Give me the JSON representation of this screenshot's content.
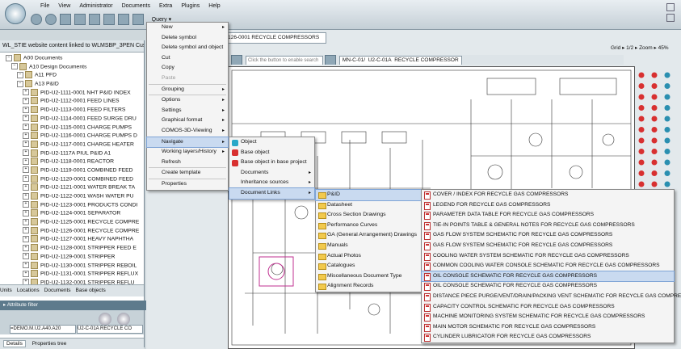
{
  "menubar": {
    "items": [
      "File",
      "View",
      "Administrator",
      "Documents",
      "Extra",
      "Plugins",
      "Help"
    ]
  },
  "toolbar": {
    "query_label": "Query"
  },
  "left_panel": {
    "header": "WL_STIE  website content linked to WLMSBP_3PEN  Cus",
    "tree": [
      {
        "indent": 1,
        "label": "A00  Documents"
      },
      {
        "indent": 2,
        "label": "A10  Design Documents"
      },
      {
        "indent": 3,
        "label": "A11   PFD"
      },
      {
        "indent": 3,
        "label": "A13   P&ID"
      },
      {
        "indent": 4,
        "label": "PID-U2-1111-0001  NHT P&ID INDEX"
      },
      {
        "indent": 4,
        "label": "PID-U2-1112-0001  FEED LINES"
      },
      {
        "indent": 4,
        "label": "PID-U2-1113-0001  FEED FILTERS"
      },
      {
        "indent": 4,
        "label": "PID-U2-1114-0001  FEED SURGE DRU"
      },
      {
        "indent": 4,
        "label": "PID-U2-1115-0001  CHARGE PUMPS"
      },
      {
        "indent": 4,
        "label": "PID-U2-1116-0001  CHARGE PUMPS D"
      },
      {
        "indent": 4,
        "label": "PID-U2-1117-0001  CHARGE HEATER"
      },
      {
        "indent": 4,
        "label": "PID-U2-1117A  PIUL P&ID A1"
      },
      {
        "indent": 4,
        "label": "PID-U2-1118-0001  REACTOR"
      },
      {
        "indent": 4,
        "label": "PID-U2-1119-0001  COMBINED FEED"
      },
      {
        "indent": 4,
        "label": "PID-U2-1120-0001  COMBINED FEED"
      },
      {
        "indent": 4,
        "label": "PID-U2-1121-0001  WATER BREAK TA"
      },
      {
        "indent": 4,
        "label": "PID-U2-1122-0001  WASH WATER PU"
      },
      {
        "indent": 4,
        "label": "PID-U2-1123-0001  PRODUCTS CONDI"
      },
      {
        "indent": 4,
        "label": "PID-U2-1124-0001  SEPARATOR"
      },
      {
        "indent": 4,
        "label": "PID-U2-1125-0001  RECYCLE COMPRE"
      },
      {
        "indent": 4,
        "label": "PID-U2-1126-0001  RECYCLE COMPRE"
      },
      {
        "indent": 4,
        "label": "PID-U2-1127-0001  HEAVY NAPHTHA"
      },
      {
        "indent": 4,
        "label": "PID-U2-1128-0001  STRIPPER FEED E"
      },
      {
        "indent": 4,
        "label": "PID-U2-1129-0001  STRIPPER"
      },
      {
        "indent": 4,
        "label": "PID-U2-1130-0001  STRIPPER REBOIL"
      },
      {
        "indent": 4,
        "label": "PID-U2-1131-0001  STRIPPER REFLUX"
      },
      {
        "indent": 4,
        "label": "PID-U2-1132-0001  STRIPPER REFLU"
      }
    ],
    "tabs": [
      "Units",
      "Locations",
      "Documents",
      "Base objects"
    ],
    "attribute_filter": "Attribute filter",
    "attr_values": [
      "=DEMO.M.U2.A40.A20",
      "U2-C-01A RECYCLE CO"
    ],
    "bottom_tabs": [
      "Details",
      "Properties tree"
    ]
  },
  "document": {
    "tab_title": "1126-0001  RECYCLE COMPRESSORS",
    "grid_label": "Grid",
    "page": "1/2",
    "zoom_label": "Zoom",
    "zoom_value": "45%",
    "input_placeholder": "Click the button to enable search",
    "breadcrumb": [
      "MN-C-01/",
      "U2-C-01A",
      "RECYCLE COMPRESSOR"
    ]
  },
  "context_menu": {
    "items": [
      {
        "label": "New",
        "arrow": true
      },
      {
        "label": "Delete symbol"
      },
      {
        "label": "Delete symbol and object"
      },
      {
        "label": "Cut"
      },
      {
        "label": "Copy"
      },
      {
        "label": "Paste",
        "disabled": true
      },
      {
        "label": "Grouping",
        "arrow": true,
        "sep": true
      },
      {
        "label": "Options",
        "arrow": true,
        "sep": true
      },
      {
        "label": "Settings",
        "arrow": true
      },
      {
        "label": "Graphical format",
        "arrow": true
      },
      {
        "label": "COMOS-3D-Viewing",
        "arrow": true
      },
      {
        "label": "Navigate",
        "arrow": true,
        "highlight": true,
        "sep": true
      },
      {
        "label": "Working layers/History",
        "arrow": true
      },
      {
        "label": "Refresh"
      },
      {
        "label": "Create template",
        "sep": true
      },
      {
        "label": "Properties",
        "sep": true
      }
    ]
  },
  "navigate_menu": {
    "items": [
      {
        "label": "Object"
      },
      {
        "label": "Base object"
      },
      {
        "label": "Base object in base project"
      },
      {
        "label": "Documents",
        "arrow": true
      },
      {
        "label": "Inheritance sources",
        "arrow": true
      },
      {
        "label": "Document Links",
        "arrow": true,
        "highlight": true
      }
    ]
  },
  "doc_types_menu": {
    "items": [
      {
        "label": "P&ID",
        "highlight": true
      },
      {
        "label": "Datasheet"
      },
      {
        "label": "Cross Section Drawings"
      },
      {
        "label": "Performance Curves"
      },
      {
        "label": "GA (General Arrangement) Drawings"
      },
      {
        "label": "Manuals"
      },
      {
        "label": "Actual Photos"
      },
      {
        "label": "Catalogues"
      },
      {
        "label": "Miscellaneous Document Type"
      },
      {
        "label": "Alignment Records"
      }
    ]
  },
  "doc_links_menu": {
    "items": [
      {
        "label": "COVER / INDEX FOR RECYCLE GAS COMPRESSORS"
      },
      {
        "label": "LEGEND FOR RECYCLE GAS COMPRESSORS"
      },
      {
        "label": "PARAMETER DATA TABLE FOR RECYCLE GAS COMPRESSORS"
      },
      {
        "label": "TIE-IN POINTS TABLE & GENERAL NOTES FOR RECYCLE GAS COMPRESSORS"
      },
      {
        "label": "GAS FLOW SYSTEM SCHEMATIC FOR RECYCLE GAS COMPRESSORS"
      },
      {
        "label": "GAS FLOW SYSTEM SCHEMATIC FOR RECYCLE GAS COMPRESSORS"
      },
      {
        "label": "COOLING WATER SYSTEM SCHEMATIC FOR RECYCLE GAS COMPRESSORS"
      },
      {
        "label": "COMMON COOLING WATER CONSOLE SCHEMATIC FOR RECYCLE GAS COMPRESSORS"
      },
      {
        "label": "OIL CONSOLE SCHEMATIC FOR RECYCLE GAS COMPRESSORS",
        "highlight": true
      },
      {
        "label": "OIL CONSOLE SCHEMATIC FOR RECYCLE GAS COMPRESSORS"
      },
      {
        "label": "DISTANCE PIECE PURGE/VENT/DRAIN/PACKING VENT SCHEMATIC FOR RECYCLE GAS COMPRESSORS"
      },
      {
        "label": "CAPACITY CONTROL SCHEMATIC FOR RECYCLE GAS COMPRESSORS"
      },
      {
        "label": "MACHINE MONITORING SYSTEM SCHEMATIC FOR RECYCLE GAS COMPRESSORS"
      },
      {
        "label": "MAIN MOTOR SCHEMATIC FOR RECYCLE GAS COMPRESSORS"
      },
      {
        "label": "CYLINDER LUBRICATOR FOR RECYCLE GAS COMPRESSORS"
      }
    ]
  },
  "colors": {
    "highlight": "#c9daf0",
    "tool_red": "#d83030",
    "accent": "#5d7a8c"
  }
}
